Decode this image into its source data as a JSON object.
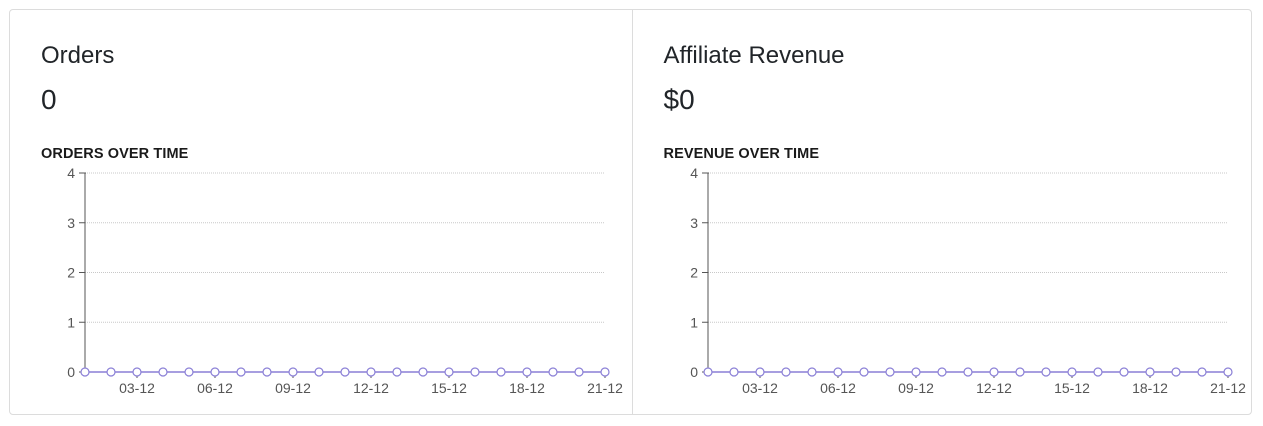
{
  "panels": [
    {
      "title": "Orders",
      "value": "0",
      "chart_title": "ORDERS OVER TIME"
    },
    {
      "title": "Affiliate Revenue",
      "value": "$0",
      "chart_title": "REVENUE OVER TIME"
    }
  ],
  "colors": {
    "line": "#8a7fd6",
    "grid": "#c8c8c8",
    "axis": "#555555",
    "border": "#dcdcdc"
  },
  "chart_data": [
    {
      "type": "line",
      "title": "ORDERS OVER TIME",
      "x": [
        "01-12",
        "02-12",
        "03-12",
        "04-12",
        "05-12",
        "06-12",
        "07-12",
        "08-12",
        "09-12",
        "10-12",
        "11-12",
        "12-12",
        "13-12",
        "14-12",
        "15-12",
        "16-12",
        "17-12",
        "18-12",
        "19-12",
        "20-12",
        "21-12"
      ],
      "xticks": [
        "03-12",
        "06-12",
        "09-12",
        "12-12",
        "15-12",
        "18-12",
        "21-12"
      ],
      "series": [
        {
          "values": [
            0,
            0,
            0,
            0,
            0,
            0,
            0,
            0,
            0,
            0,
            0,
            0,
            0,
            0,
            0,
            0,
            0,
            0,
            0,
            0,
            0
          ]
        }
      ],
      "yticks": [
        0,
        1,
        2,
        3,
        4
      ],
      "ylim": [
        0,
        4
      ],
      "grid": true
    },
    {
      "type": "line",
      "title": "REVENUE OVER TIME",
      "x": [
        "01-12",
        "02-12",
        "03-12",
        "04-12",
        "05-12",
        "06-12",
        "07-12",
        "08-12",
        "09-12",
        "10-12",
        "11-12",
        "12-12",
        "13-12",
        "14-12",
        "15-12",
        "16-12",
        "17-12",
        "18-12",
        "19-12",
        "20-12",
        "21-12"
      ],
      "xticks": [
        "03-12",
        "06-12",
        "09-12",
        "12-12",
        "15-12",
        "18-12",
        "21-12"
      ],
      "series": [
        {
          "values": [
            0,
            0,
            0,
            0,
            0,
            0,
            0,
            0,
            0,
            0,
            0,
            0,
            0,
            0,
            0,
            0,
            0,
            0,
            0,
            0,
            0
          ]
        }
      ],
      "yticks": [
        0,
        1,
        2,
        3,
        4
      ],
      "ylim": [
        0,
        4
      ],
      "grid": true
    }
  ]
}
